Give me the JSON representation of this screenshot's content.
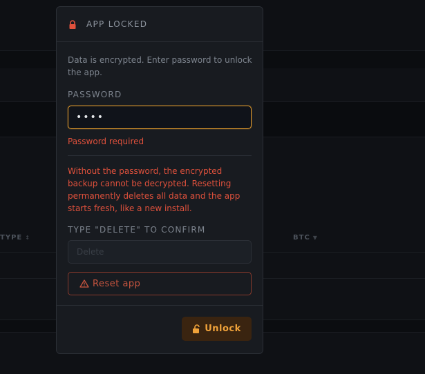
{
  "background": {
    "columns": [
      {
        "label": "TYPE",
        "sort_icon": "sort-arrows-icon"
      },
      {
        "label": "BTC",
        "sort_icon": "sort-desc-icon"
      }
    ]
  },
  "modal": {
    "title": "APP LOCKED",
    "title_icon": "lock-icon",
    "description": "Data is encrypted. Enter password to unlock the app.",
    "password_label": "PASSWORD",
    "password_value": "••••",
    "password_error": "Password required",
    "warning": "Without the password, the encrypted backup cannot be decrypted. Resetting permanently deletes all data and the app starts fresh, like a new install.",
    "confirm_label": "TYPE \"DELETE\" TO CONFIRM",
    "confirm_placeholder": "Delete",
    "confirm_value": "",
    "reset_label": "Reset app",
    "reset_icon": "warning-icon",
    "unlock_label": "Unlock",
    "unlock_icon": "unlock-icon"
  },
  "colors": {
    "accent": "#e09a2c",
    "danger": "#e0513c",
    "unlock_bg": "#3a2410",
    "modal_bg": "#181b20"
  }
}
